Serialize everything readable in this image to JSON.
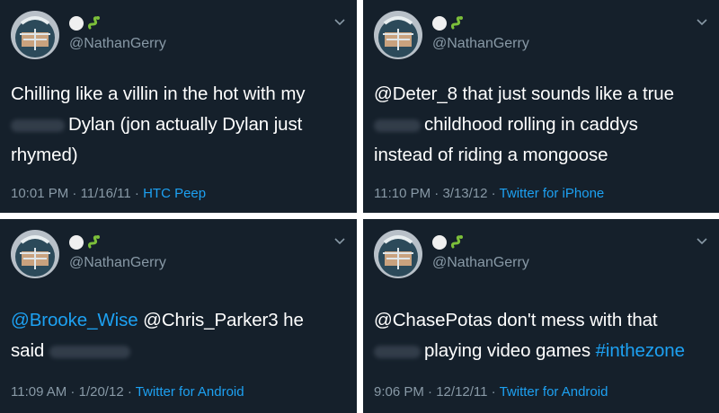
{
  "colors": {
    "card_bg": "#15202b",
    "text": "#ffffff",
    "muted": "#8899a6",
    "link": "#1da1f2"
  },
  "icons": [
    "avatar",
    "white-circle-emoji",
    "snake-emoji",
    "chevron-down-icon",
    "redacted-text"
  ],
  "tweets": [
    {
      "handle": "@NathanGerry",
      "lines": [
        "Chilling like a villin in the hot with my",
        "Dylan (jon actually Dylan just",
        "rhymed)"
      ],
      "time": "10:01 PM",
      "date": "11/16/11",
      "source": "HTC Peep"
    },
    {
      "handle": "@NathanGerry",
      "mention": "@Deter_8",
      "lines": [
        " that just sounds like a true",
        "childhood rolling in caddys",
        "instead of riding a mongoose"
      ],
      "time": "11:10 PM",
      "date": "3/13/12",
      "source": "Twitter for iPhone"
    },
    {
      "handle": "@NathanGerry",
      "mention": "@Brooke_Wise",
      "lines": [
        " @Chris_Parker3 he",
        "said"
      ],
      "time": "11:09 AM",
      "date": "1/20/12",
      "source": "Twitter for Android"
    },
    {
      "handle": "@NathanGerry",
      "lines": [
        "@ChasePotas don't mess with that",
        "playing video games "
      ],
      "hashtag": "#inthezone",
      "time": "9:06 PM",
      "date": "12/12/11",
      "source": "Twitter for Android"
    }
  ],
  "sep": " · "
}
